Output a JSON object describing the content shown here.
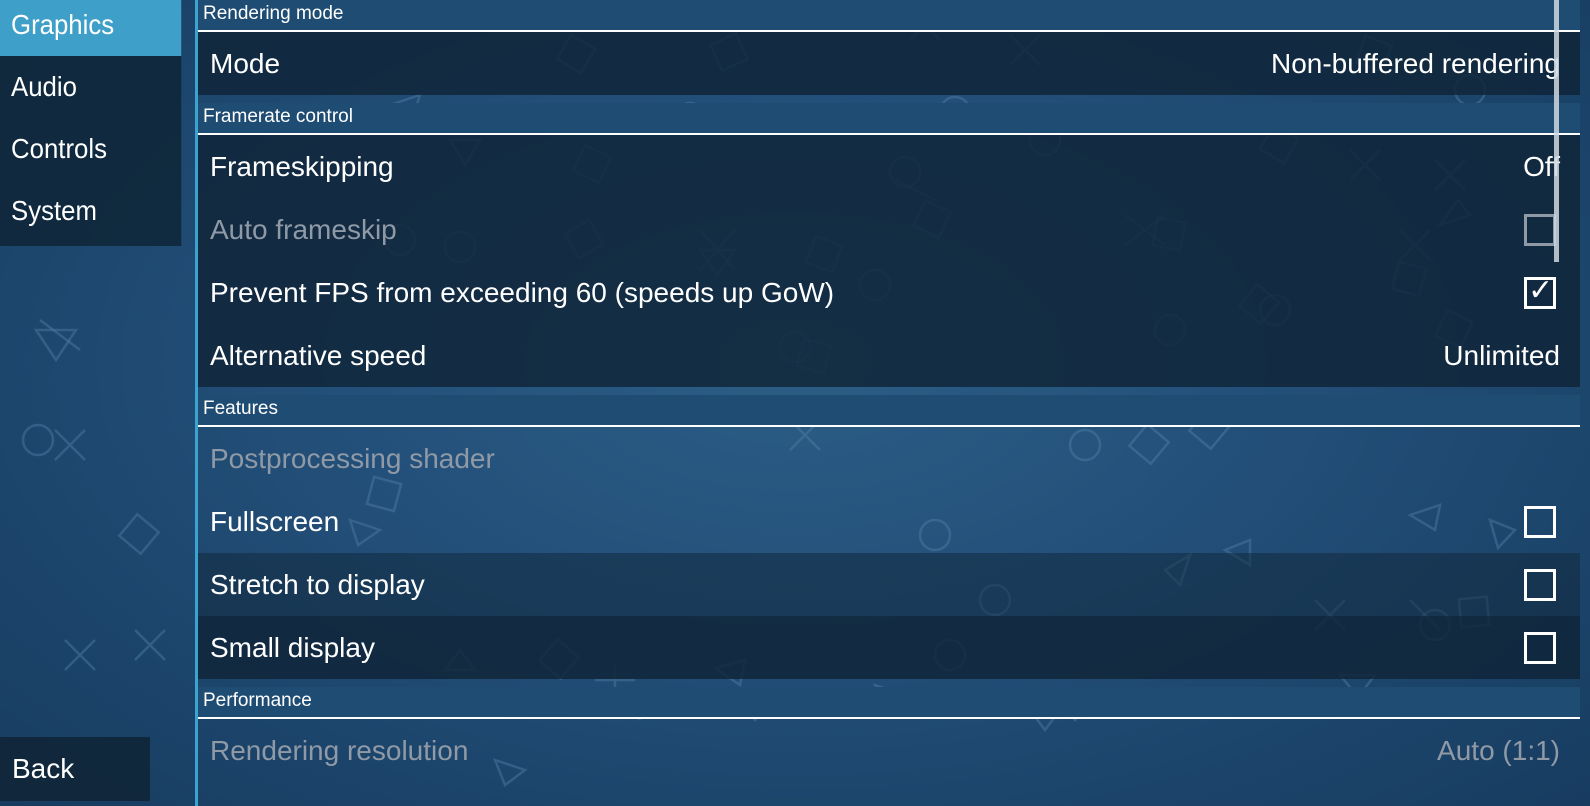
{
  "sidebar": {
    "tabs": [
      {
        "label": "Graphics",
        "active": true
      },
      {
        "label": "Audio",
        "active": false
      },
      {
        "label": "Controls",
        "active": false
      },
      {
        "label": "System",
        "active": false
      }
    ],
    "back_label": "Back"
  },
  "sections": {
    "rendering_mode": {
      "header": "Rendering mode",
      "mode": {
        "label": "Mode",
        "value": "Non-buffered rendering"
      }
    },
    "framerate_control": {
      "header": "Framerate control",
      "frameskipping": {
        "label": "Frameskipping",
        "value": "Off"
      },
      "auto_frameskip": {
        "label": "Auto frameskip",
        "checked": false,
        "enabled": false
      },
      "prevent_fps": {
        "label": "Prevent FPS from exceeding 60 (speeds up GoW)",
        "checked": true,
        "check_glyph": "✓"
      },
      "alternative_speed": {
        "label": "Alternative speed",
        "value": "Unlimited"
      }
    },
    "features": {
      "header": "Features",
      "postprocessing_shader": {
        "label": "Postprocessing shader",
        "enabled": false
      },
      "fullscreen": {
        "label": "Fullscreen",
        "checked": false
      },
      "stretch_to_display": {
        "label": "Stretch to display",
        "checked": false
      },
      "small_display": {
        "label": "Small display",
        "checked": false
      }
    },
    "performance": {
      "header": "Performance",
      "rendering_resolution": {
        "label": "Rendering resolution",
        "value": "Auto (1:1)",
        "enabled": false
      }
    }
  },
  "colors": {
    "accent": "#3ea0c8",
    "background": "#23507a",
    "row_background": "#0f2538",
    "disabled_text": "#8f9aa6"
  }
}
